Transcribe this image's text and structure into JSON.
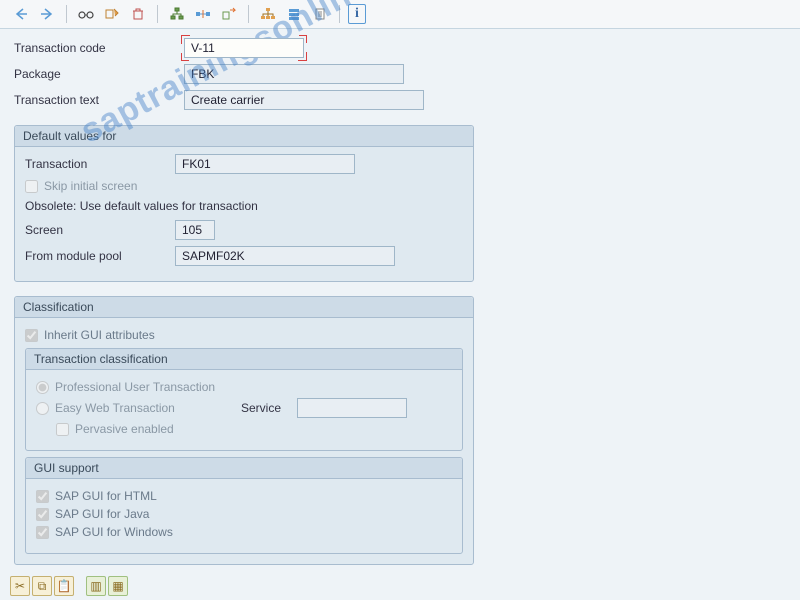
{
  "toolbar": {
    "info_icon": "i"
  },
  "header": {
    "tcode_label": "Transaction code",
    "tcode_value": "V-11",
    "package_label": "Package",
    "package_value": "FBK",
    "ttext_label": "Transaction text",
    "ttext_value": "Create carrier"
  },
  "defaults": {
    "title": "Default values for",
    "transaction_label": "Transaction",
    "transaction_value": "FK01",
    "skip_label": "Skip initial screen",
    "obsolete_text": "Obsolete: Use default values for transaction",
    "screen_label": "Screen",
    "screen_value": "105",
    "modpool_label": "From module pool",
    "modpool_value": "SAPMF02K"
  },
  "classification": {
    "title": "Classification",
    "inherit_label": "Inherit GUI attributes",
    "sub_title": "Transaction classification",
    "prof_label": "Professional User Transaction",
    "easy_label": "Easy Web Transaction",
    "service_label": "Service",
    "pervasive_label": "Pervasive enabled"
  },
  "gui": {
    "title": "GUI support",
    "html_label": "SAP GUI for HTML",
    "java_label": "SAP GUI for Java",
    "win_label": "SAP GUI for Windows"
  },
  "watermark": "saptrainingsonline.com"
}
